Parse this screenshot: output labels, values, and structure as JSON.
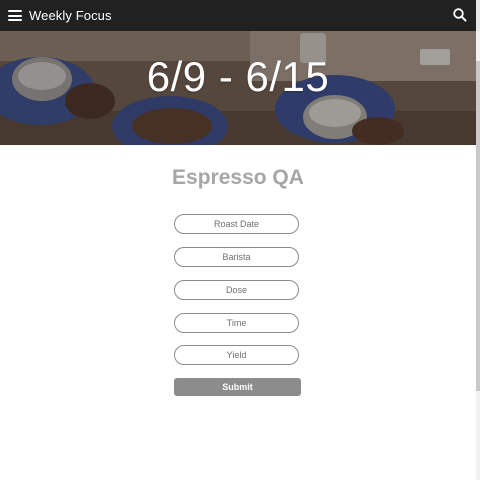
{
  "app_bar": {
    "title": "Weekly Focus",
    "menu_icon": "hamburger-menu-icon",
    "search_icon": "search-icon",
    "background": "#212121"
  },
  "hero": {
    "date_range": "6/9 - 6/15"
  },
  "form": {
    "title": "Espresso QA",
    "fields": [
      {
        "placeholder": "Roast Date",
        "value": ""
      },
      {
        "placeholder": "Barista",
        "value": ""
      },
      {
        "placeholder": "Dose",
        "value": ""
      },
      {
        "placeholder": "Time",
        "value": ""
      },
      {
        "placeholder": "Yield",
        "value": ""
      }
    ],
    "submit_label": "Submit",
    "title_color": "#a6a6a6",
    "button_color": "#8c8c8c"
  }
}
